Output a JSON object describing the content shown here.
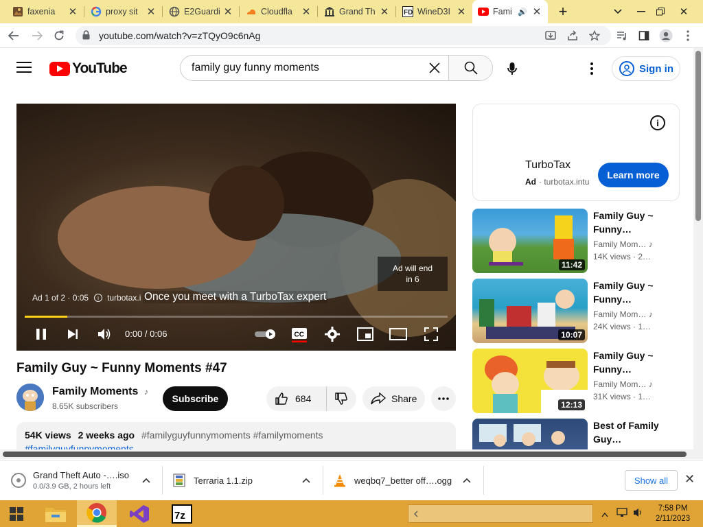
{
  "tabs": [
    {
      "label": "faxenia",
      "icon": "image-icon"
    },
    {
      "label": "proxy sit",
      "icon": "google-icon"
    },
    {
      "label": "E2Guardi",
      "icon": "globe-icon"
    },
    {
      "label": "Cloudfla",
      "icon": "cloudflare-icon"
    },
    {
      "label": "Grand Th",
      "icon": "institution-icon"
    },
    {
      "label": "WineD3I",
      "icon": "fd-icon"
    },
    {
      "label": "Fami",
      "icon": "youtube-icon",
      "active": true
    }
  ],
  "browser": {
    "url": "youtube.com/watch?v=zTQyO9c6nAg"
  },
  "youtube": {
    "logo_text": "YouTube",
    "search_value": "family guy funny moments",
    "signin_label": "Sign in"
  },
  "player": {
    "ad_will_end": "Ad will end",
    "ad_will_end_2": "in 6",
    "ad_counter": "Ad 1 of 2 · 0:05",
    "ad_domain": "turbotax.i",
    "caption": "Once you meet with a TurboTax expert",
    "time": "0:00 / 0:06",
    "progress": 0.1,
    "cc_label": "CC"
  },
  "video": {
    "title": "Family Guy ~ Funny Moments #47",
    "channel": "Family Moments",
    "subscribers": "8.65K subscribers",
    "subscribe_label": "Subscribe",
    "likes": "684",
    "share_label": "Share",
    "views": "54K views",
    "age": "2 weeks ago",
    "hashtags": "#familyguyfunnymoments #familymoments",
    "hashtags_2": "#familyguyfunnymoments"
  },
  "ad_card": {
    "brand": "TurboTax",
    "ad_label": "Ad",
    "domain": "· turbotax.intu",
    "cta": "Learn more"
  },
  "recommendations": [
    {
      "title_1": "Family Guy ~",
      "title_2": "Funny…",
      "channel": "Family Mom…",
      "views": "14K views · 2…",
      "duration": "11:42"
    },
    {
      "title_1": "Family Guy ~",
      "title_2": "Funny…",
      "channel": "Family Mom…",
      "views": "24K views · 1…",
      "duration": "10:07"
    },
    {
      "title_1": "Family Guy ~",
      "title_2": "Funny…",
      "channel": "Family Mom…",
      "views": "31K views · 1…",
      "duration": "12:13"
    },
    {
      "title_1": "Best of Family",
      "title_2": "Guy…",
      "channel": "",
      "views": "",
      "duration": ""
    }
  ],
  "downloads": [
    {
      "name": "Grand Theft Auto -….iso",
      "sub": "0.0/3.9 GB, 2 hours left",
      "icon": "disc-image-icon"
    },
    {
      "name": "Terraria 1.1.zip",
      "sub": "",
      "icon": "zip-archive-icon"
    },
    {
      "name": "weqbq7_better off….ogg",
      "sub": "",
      "icon": "vlc-cone-icon"
    }
  ],
  "downloads_show_all": "Show all",
  "taskbar": {
    "time": "7:58 PM",
    "date": "2/11/2023"
  },
  "colors": {
    "tabstrip": "#f4e79a",
    "taskbar": "#e0a436",
    "youtube_red": "#ff0000",
    "link_blue": "#065fd4",
    "ad_progress": "#fcd116"
  }
}
